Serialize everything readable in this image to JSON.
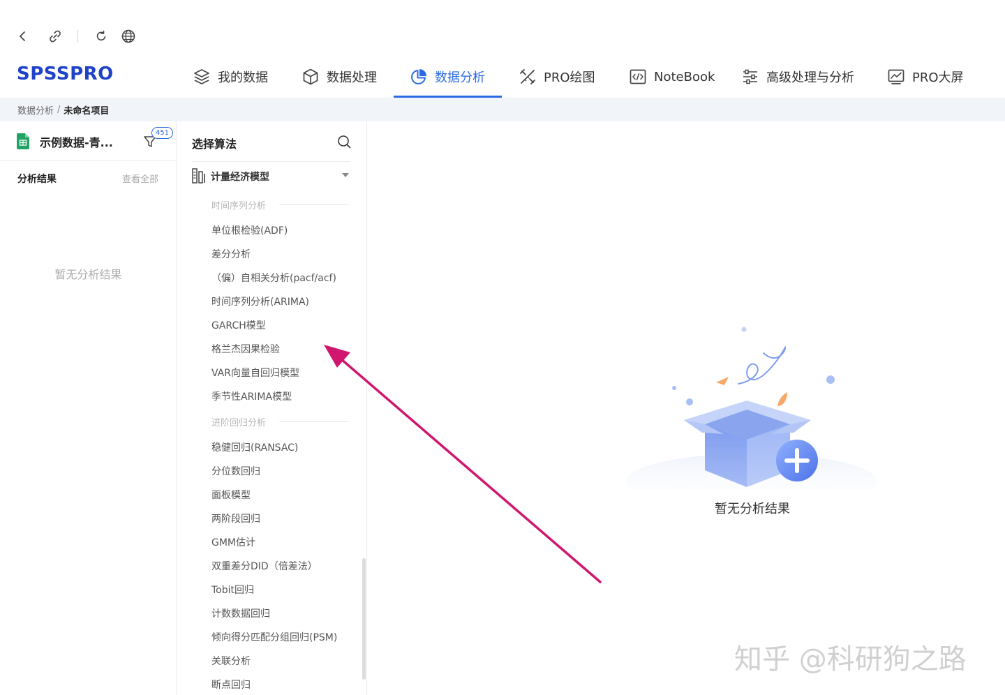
{
  "browser": {
    "icons": [
      "back-icon",
      "link-icon",
      "refresh-icon",
      "globe-icon"
    ]
  },
  "header": {
    "logo": "SPSSPRO",
    "nav": [
      {
        "label": "我的数据",
        "icon": "layers-icon"
      },
      {
        "label": "数据处理",
        "icon": "cube-icon"
      },
      {
        "label": "数据分析",
        "icon": "pie-chart-icon",
        "active": true
      },
      {
        "label": "PRO绘图",
        "icon": "drawing-tools-icon"
      },
      {
        "label": "NoteBook",
        "icon": "code-icon"
      },
      {
        "label": "高级处理与分析",
        "icon": "sliders-icon"
      },
      {
        "label": "PRO大屏",
        "icon": "monitor-chart-icon"
      }
    ],
    "accent_color": "#2c6ae3"
  },
  "breadcrumb": {
    "parent": "数据分析",
    "separator": "/",
    "current": "未命名项目"
  },
  "left_panel": {
    "dataset_name": "示例数据-青...",
    "row_count": "451",
    "results_title": "分析结果",
    "view_all": "查看全部",
    "empty_text": "暂无分析结果"
  },
  "algorithm_panel": {
    "title": "选择算法",
    "category": "计量经济模型",
    "groups": [
      {
        "name": "时间序列分析",
        "items": [
          "单位根检验(ADF)",
          "差分分析",
          "（偏）自相关分析(pacf/acf)",
          "时间序列分析(ARIMA)",
          "GARCH模型",
          "格兰杰因果检验",
          "VAR向量自回归模型",
          "季节性ARIMA模型"
        ]
      },
      {
        "name": "进阶回归分析",
        "items": [
          "稳健回归(RANSAC)",
          "分位数回归",
          "面板模型",
          "两阶段回归",
          "GMM估计",
          "双重差分DID（倍差法）",
          "Tobit回归",
          "计数数据回归",
          "倾向得分匹配分组回归(PSM)",
          "关联分析",
          "断点回归"
        ]
      }
    ]
  },
  "main": {
    "empty_text": "暂无分析结果"
  },
  "annotation": {
    "color": "#d0166e"
  },
  "watermark": "知乎 @科研狗之路"
}
